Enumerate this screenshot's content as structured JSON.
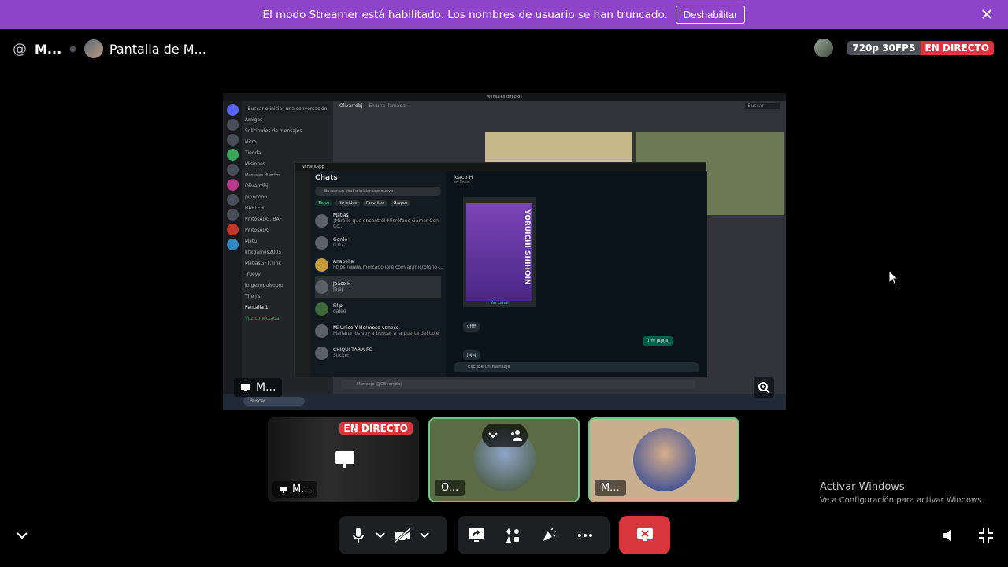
{
  "banner": {
    "message": "El modo Streamer está habilitado. Los nombres de usuario se han truncado.",
    "button_label": "Deshabilitar"
  },
  "topbar": {
    "channel": "M...",
    "title": "Pantalla de M...",
    "quality": "720p 30FPS",
    "live": "EN DIRECTO"
  },
  "screen": {
    "window_title": "Mensajes directos",
    "dm_search": "Buscar o iniciar una conversación",
    "dm_items": [
      "Amigos",
      "Solicitudes de mensajes",
      "Nitro",
      "Tienda",
      "Misiones"
    ],
    "dm_section": "Mensajes directos",
    "dm_users": [
      "Olivarrdbj",
      "pitinoooo",
      "BARTEH",
      "PititosADG, BAF",
      "PititosADG",
      "Matu",
      "linkgames2005",
      "MatiasGFT, link",
      "Trueyy",
      "jorgeimpulsopro",
      "The J's"
    ],
    "voice_status": "Voz conectada",
    "voice_channel": "Pantalla 1",
    "header_user": "Olivarrdbj",
    "header_sub": "En una llamada",
    "search": "Buscar",
    "taskbar_search": "Buscar",
    "message_placeholder": "Mensaje @Olivarrdbj",
    "overlay_label": "M..."
  },
  "whatsapp": {
    "app": "WhatsApp",
    "heading": "Chats",
    "search": "Buscar un chat o iniciar uno nuevo",
    "filters": [
      "Todos",
      "No leídos",
      "Favoritos",
      "Grupos"
    ],
    "chats": [
      {
        "name": "Matias",
        "preview": "¡Mirá lo que encontré! Micrófono Gamer Con Co...",
        "time": "17:04"
      },
      {
        "name": "Gordo",
        "preview": "0:07",
        "time": "13:26"
      },
      {
        "name": "Anabella",
        "preview": "https://www.mercadolibre.com.ar/microfono-...",
        "time": "19:03"
      },
      {
        "name": "Joaco H",
        "preview": "Jajaj",
        "time": "20:37"
      },
      {
        "name": "Filip",
        "preview": "dalee",
        "time": "20:14"
      },
      {
        "name": "Mi Unico Y Hermoso veneco",
        "preview": "Mañana los voy a buscar a la puerta del cole",
        "time": "19:40"
      },
      {
        "name": "CHIQUI TAPIA FC",
        "preview": "Sticker",
        "time": "18:34"
      }
    ],
    "chat_name": "Joaco H",
    "chat_status": "en línea",
    "poster_title": "YORUICHI SHIHOIN",
    "poster_caption": "Ver canal",
    "msg_in_1": "uffff",
    "msg_out": "uffff jajajaj",
    "msg_in_2": "Jajaj",
    "input_placeholder": "Escribe un mensaje"
  },
  "tiles": [
    {
      "name": "M...",
      "badge": "EN DIRECTO"
    },
    {
      "name": "O..."
    },
    {
      "name": "M..."
    }
  ],
  "watermark": {
    "line1": "Activar Windows",
    "line2": "Ve a Configuración para activar Windows."
  },
  "colors": {
    "banner": "#8e44c8",
    "live": "#da373c",
    "speaking": "#6fc384",
    "end_call": "#da373c"
  }
}
